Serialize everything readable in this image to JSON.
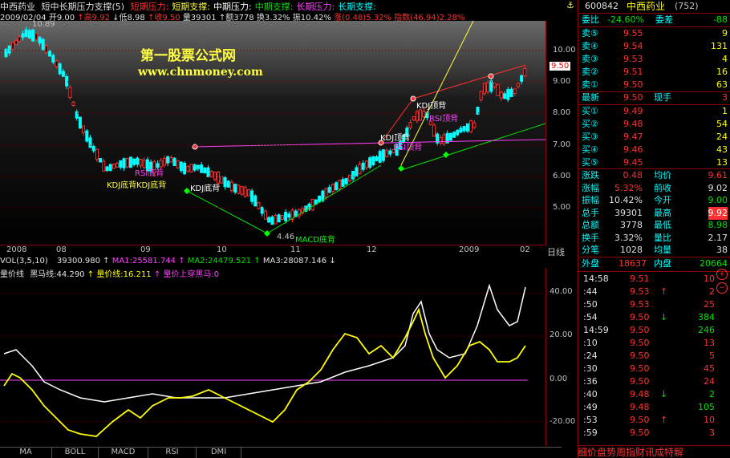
{
  "title": {
    "stock": "中西药业",
    "indicator": "短中长期压力支撑(5)",
    "items": [
      {
        "text": "短期压力:",
        "color": "#ff3030"
      },
      {
        "text": "短期支撑:",
        "color": "#ffff40"
      },
      {
        "text": "中期压力:",
        "color": "#ffffff"
      },
      {
        "text": "中期支撑:",
        "color": "#00e000"
      },
      {
        "text": "长期压力:",
        "color": "#ff40ff"
      },
      {
        "text": "长期支撑:",
        "color": "#00ffff"
      }
    ]
  },
  "info": {
    "date": "2009/02/04",
    "open": "开9.00",
    "high": "高9.92",
    "low": "低8.98",
    "close": "收9.50",
    "vol": "量39301",
    "amount": "额3778",
    "turnover": "换3.32%",
    "amp": "振10.42%",
    "rise": "涨(0.48)5.32%",
    "index": "指数(46.94)2.28%"
  },
  "watermark": {
    "line1": "第一股票公式网",
    "line2": "www.chnmoney.com"
  },
  "annotations": [
    {
      "text": "KDJ底背",
      "color": "#ffff40"
    },
    {
      "text": "RSI底背",
      "color": "#ff40ff"
    },
    {
      "text": "KDJ底背",
      "color": "#ffff40"
    },
    {
      "text": "KDJ底背",
      "color": "#ffffff"
    },
    {
      "text": "4.46",
      "color": "#c0c0c0"
    },
    {
      "text": "MACD底背",
      "color": "#00ff00"
    },
    {
      "text": "KDJ顶背",
      "color": "#ffffff"
    },
    {
      "text": "RSI顶背",
      "color": "#ff40ff"
    },
    {
      "text": "KDJ顶背",
      "color": "#ffffff"
    },
    {
      "text": "RSI顶背",
      "color": "#ff40ff"
    },
    {
      "text": "10.89",
      "color": "#c0c0c0"
    }
  ],
  "date_axis": [
    "2008",
    "08",
    "09",
    "10",
    "11",
    "12",
    "2009",
    "02"
  ],
  "price_axis": [
    "10.00",
    "9.00",
    "8.00",
    "7.00",
    "6.00",
    "5.00"
  ],
  "current_price_tag": "9.50",
  "day_label": "日线",
  "vol_bar": {
    "label": "VOL(3,5,10)",
    "vol": "39300.980",
    "ma1": "MA1:25581.744",
    "ma2": "MA2:24479.521",
    "ma3": "MA3:28087.146"
  },
  "ind_bar": {
    "name": "量价线",
    "a": "黑马线:44.290",
    "b": "量价线:16.211",
    "c": "量价上穿黑马:0"
  },
  "lower_axis": [
    "40.00",
    "20.00",
    "0.00",
    "-20.00"
  ],
  "tabs": [
    "MA",
    "BOLL",
    "MACD",
    "RSI",
    "DMI"
  ],
  "panel": {
    "code": "600842",
    "name": "中西药业",
    "count": "(752)",
    "weibi_label": "委比",
    "weibi": "-24.60%",
    "weicha_label": "委差",
    "weicha": "-88",
    "asks": [
      {
        "label": "卖⑤",
        "price": "9.55",
        "vol": "9"
      },
      {
        "label": "卖④",
        "price": "9.54",
        "vol": "131"
      },
      {
        "label": "卖③",
        "price": "9.53",
        "vol": "4"
      },
      {
        "label": "卖②",
        "price": "9.51",
        "vol": "16"
      },
      {
        "label": "卖①",
        "price": "9.50",
        "vol": "63"
      }
    ],
    "latest_label": "最新",
    "latest": "9.50",
    "xianshou_label": "现手",
    "xianshou": "3",
    "bids": [
      {
        "label": "买①",
        "price": "9.49",
        "vol": "1"
      },
      {
        "label": "买②",
        "price": "9.48",
        "vol": "54"
      },
      {
        "label": "买③",
        "price": "9.47",
        "vol": "24"
      },
      {
        "label": "买④",
        "price": "9.46",
        "vol": "43"
      },
      {
        "label": "买⑤",
        "price": "9.45",
        "vol": "13"
      }
    ],
    "stats": [
      {
        "l1": "涨跌",
        "v1": "0.48",
        "c1": "#ff3030",
        "l2": "均价",
        "v2": "9.61",
        "c2": "#ff3030"
      },
      {
        "l1": "涨幅",
        "v1": "5.32%",
        "c1": "#ff3030",
        "l2": "前收",
        "v2": "9.02",
        "c2": "#e0e0e0"
      },
      {
        "l1": "振幅",
        "v1": "10.42%",
        "c1": "#e0e0e0",
        "l2": "今开",
        "v2": "9.00",
        "c2": "#00e000"
      },
      {
        "l1": "总手",
        "v1": "39301",
        "c1": "#e0e0e0",
        "l2": "最高",
        "v2": "9.92",
        "c2": "#ffffff"
      },
      {
        "l1": "总额",
        "v1": "3778",
        "c1": "#e0e0e0",
        "l2": "最低",
        "v2": "8.98",
        "c2": "#00e000"
      },
      {
        "l1": "换手",
        "v1": "3.32%",
        "c1": "#e0e0e0",
        "l2": "量比",
        "v2": "2.17",
        "c2": "#e0e0e0"
      },
      {
        "l1": "分笔",
        "v1": "1028",
        "c1": "#e0e0e0",
        "l2": "均量",
        "v2": "38",
        "c2": "#e0e0e0"
      }
    ],
    "waipan_label": "外盘",
    "waipan": "18637",
    "neipan_label": "内盘",
    "neipan": "20664",
    "ticks": [
      {
        "t": "14:58",
        "p": "9.51",
        "pc": "#ff3030",
        "a": "",
        "v": "10",
        "vc": "#ff3030"
      },
      {
        "t": ":44",
        "p": "9.53",
        "pc": "#ff3030",
        "a": "↑",
        "v": "2",
        "vc": "#ff3030"
      },
      {
        "t": ":50",
        "p": "9.53",
        "pc": "#ff3030",
        "a": "",
        "v": "25",
        "vc": "#ff3030"
      },
      {
        "t": ":54",
        "p": "9.50",
        "pc": "#ff3030",
        "a": "↓",
        "v": "384",
        "vc": "#00e000"
      },
      {
        "t": "14:59",
        "p": "9.50",
        "pc": "#ff3030",
        "a": "",
        "v": "246",
        "vc": "#00e000"
      },
      {
        "t": ":10",
        "p": "9.50",
        "pc": "#ff3030",
        "a": "",
        "v": "13",
        "vc": "#ff3030"
      },
      {
        "t": ":24",
        "p": "9.50",
        "pc": "#ff3030",
        "a": "",
        "v": "5",
        "vc": "#ff3030"
      },
      {
        "t": ":30",
        "p": "9.50",
        "pc": "#ff3030",
        "a": "",
        "v": "45",
        "vc": "#ff3030"
      },
      {
        "t": ":36",
        "p": "9.50",
        "pc": "#ff3030",
        "a": "",
        "v": "24",
        "vc": "#ff3030"
      },
      {
        "t": ":40",
        "p": "9.48",
        "pc": "#ff3030",
        "a": "↓",
        "v": "2",
        "vc": "#00e000"
      },
      {
        "t": ":49",
        "p": "9.48",
        "pc": "#ff3030",
        "a": "",
        "v": "105",
        "vc": "#00e000"
      },
      {
        "t": ":53",
        "p": "9.50",
        "pc": "#ff3030",
        "a": "↑",
        "v": "10",
        "vc": "#ff3030"
      },
      {
        "t": ":59",
        "p": "9.50",
        "pc": "#ff3030",
        "a": "",
        "v": "3",
        "vc": "#ff3030"
      }
    ],
    "bottom_tools": "细价盘势周指财讯成特解"
  }
}
